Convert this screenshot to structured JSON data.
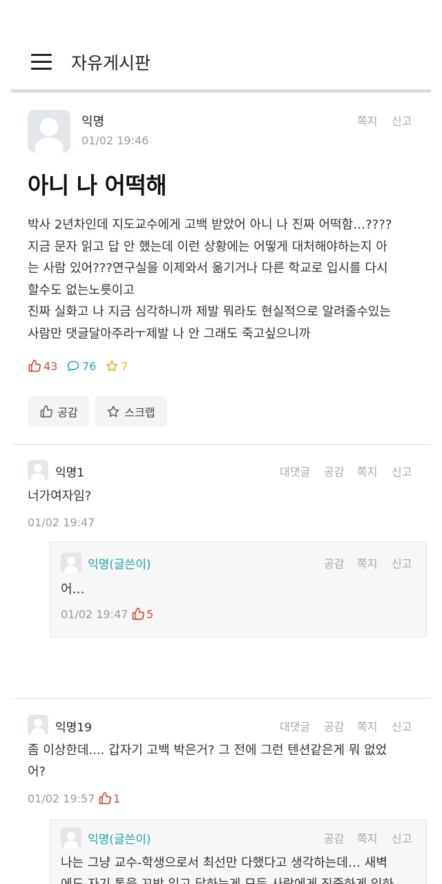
{
  "header": {
    "title": "자유게시판",
    "menu_icon": "hamburger-menu-icon"
  },
  "post": {
    "author": "익명",
    "time": "01/02 19:46",
    "actions": {
      "message": "쪽지",
      "report": "신고"
    },
    "title": "아니 나 어떡해",
    "body_lines": [
      "박사 2년차인데 지도교수에게 고백 받았어 아니 나 진짜 어떡함…????",
      "지금 문자 읽고 답 안 했는데 이런 상황에는 어떻게 대처해야하는지 아",
      "는 사람 있어???연구실을 이제와서 옮기거나 다른 학교로 입시를 다시",
      "할수도 없는노릇이고",
      "진짜 실화고 나 지금 심각하니까 제발 뭐라도 현실적으로 알려줄수있는",
      "사람만 댓글달아주라ㅜ제발 나 안 그래도 죽고싶으니까"
    ],
    "stats": {
      "likes": "43",
      "comments": "76",
      "scraps": "7"
    },
    "buttons": {
      "like": "공감",
      "scrap": "스크랩"
    }
  },
  "comments": [
    {
      "author": "익명1",
      "actions": {
        "reply": "대댓글",
        "like": "공감",
        "message": "쪽지",
        "report": "신고"
      },
      "text_lines": [
        "너가여자임?"
      ],
      "time": "01/02 19:47",
      "replies": [
        {
          "author": "익명(글쓴이)",
          "actions": {
            "like": "공감",
            "message": "쪽지",
            "report": "신고"
          },
          "text_lines": [
            "어…"
          ],
          "time": "01/02 19:47",
          "likes": "5"
        }
      ]
    },
    {
      "author": "익명19",
      "actions": {
        "reply": "대댓글",
        "like": "공감",
        "message": "쪽지",
        "report": "신고"
      },
      "text_lines": [
        "좀 이상한데.... 갑자기 고백 박은거? 그 전에 그런 텐션같은게 뭐 없었",
        "어?"
      ],
      "time": "01/02 19:57",
      "likes": "1",
      "replies": [
        {
          "author": "익명(글쓴이)",
          "actions": {
            "like": "공감",
            "message": "쪽지",
            "report": "신고"
          },
          "text_lines": [
            "나는 그냥 교수-학생으로서 최선만 다했다고 생각하는데… 새벽",
            "에도 자기 톡을 꼬박 읽고 답하는게 모든 사람에게 진중하게 임하"
          ]
        }
      ]
    }
  ],
  "colors": {
    "like": "#d14b2f",
    "comment": "#2aa7c9",
    "scrap": "#e6b422",
    "writer": "#1aa5a5",
    "muted": "#a6a6a6"
  }
}
